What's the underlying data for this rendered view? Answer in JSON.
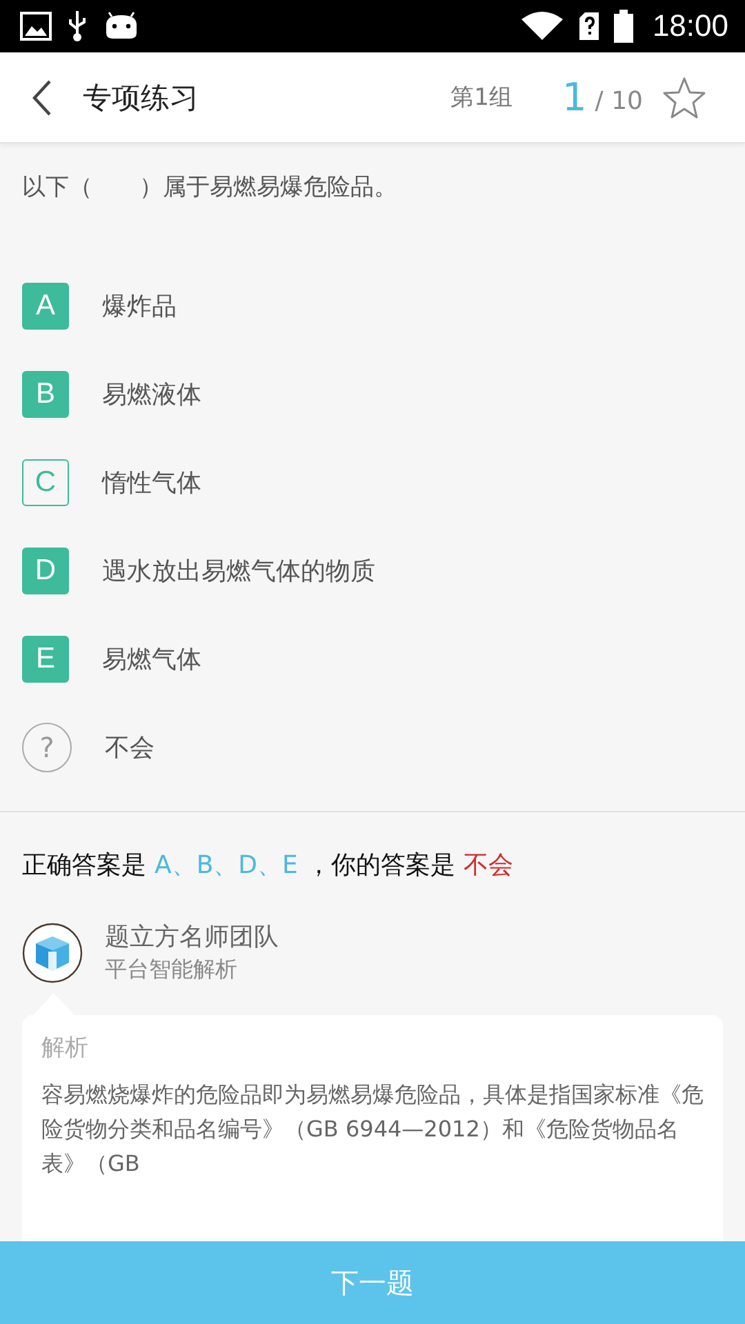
{
  "status_bar": {
    "time": "18:00"
  },
  "header": {
    "title": "专项练习",
    "group": "第1组",
    "current": "1",
    "total": "/ 10",
    "starred": false
  },
  "question": "以下（　　）属于易燃易爆危险品。",
  "options": [
    {
      "kind": "letter",
      "letter": "A",
      "text": "爆炸品",
      "correct": true
    },
    {
      "kind": "letter",
      "letter": "B",
      "text": "易燃液体",
      "correct": true
    },
    {
      "kind": "letter",
      "letter": "C",
      "text": "惰性气体",
      "correct": false
    },
    {
      "kind": "letter",
      "letter": "D",
      "text": "遇水放出易燃气体的物质",
      "correct": true
    },
    {
      "kind": "letter",
      "letter": "E",
      "text": "易燃气体",
      "correct": true
    },
    {
      "kind": "unknown",
      "letter": "?",
      "text": "不会",
      "correct": false
    }
  ],
  "answer": {
    "label": "正确答案是",
    "correct": "A、B、D、E",
    "your_label": "，你的答案是",
    "yours": "不会"
  },
  "analyst": {
    "name": "题立方名师团队",
    "subtitle": "平台智能解析"
  },
  "analysis": {
    "title": "解析",
    "text": "容易燃烧爆炸的危险品即为易燃易爆危险品，具体是指国家标准《危险货物分类和品名编号》（GB 6944—2012）和《危险货物品名表》（GB"
  },
  "next_button": "下一题"
}
